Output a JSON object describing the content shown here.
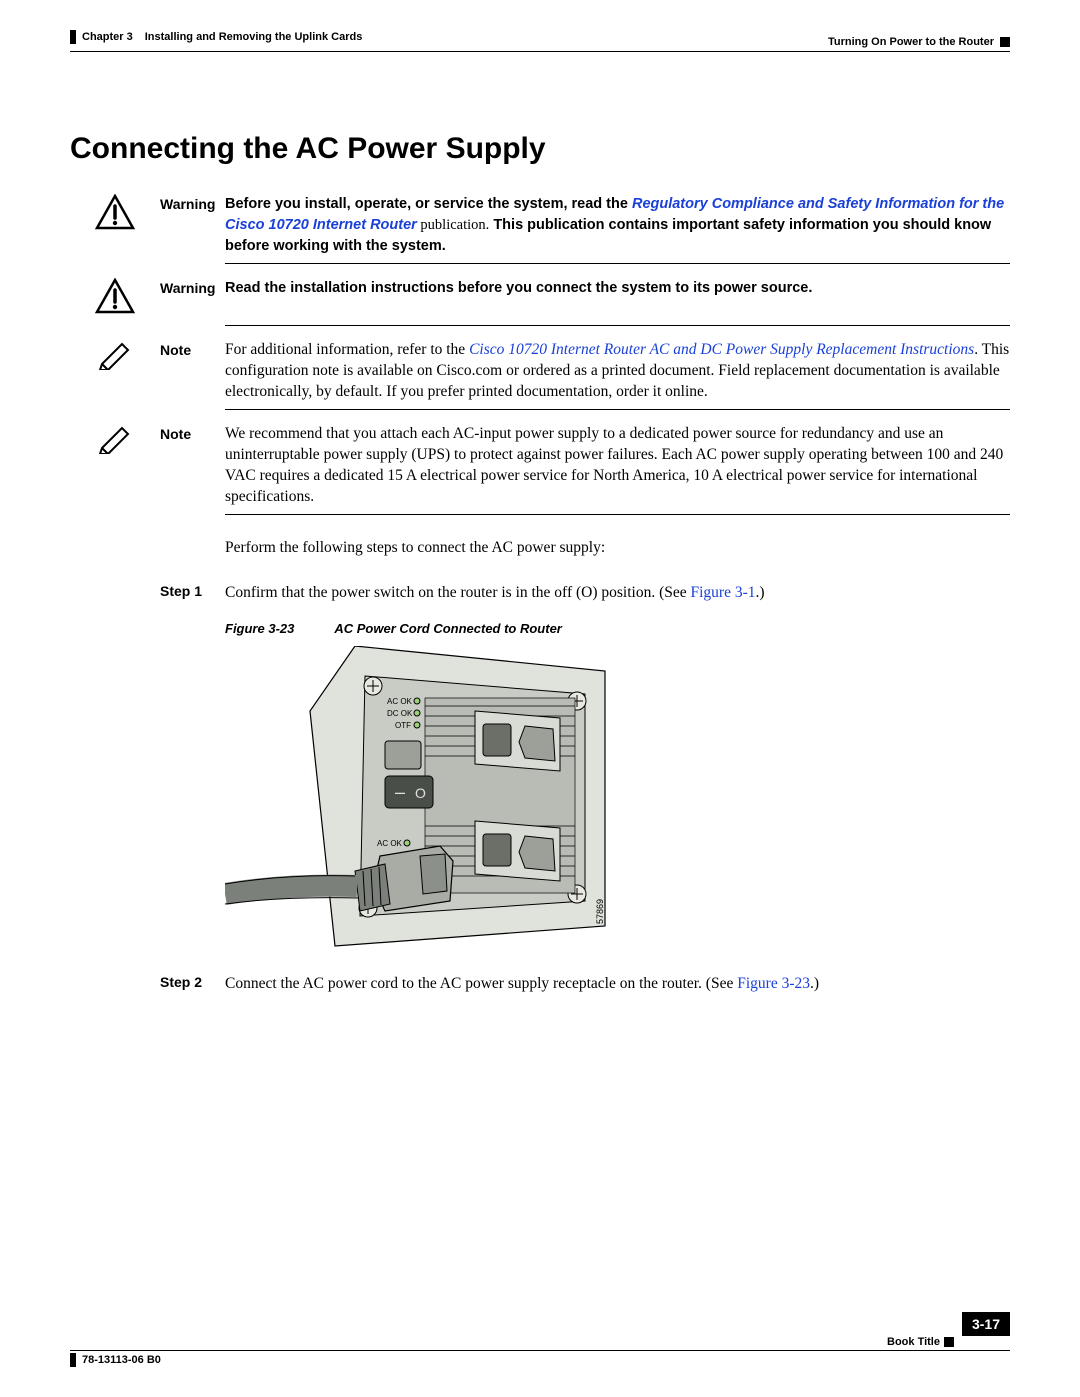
{
  "header": {
    "chapter_label": "Chapter 3",
    "chapter_title": "Installing and Removing the Uplink Cards",
    "section_title": "Turning On Power to the Router"
  },
  "heading": "Connecting the AC Power Supply",
  "warning_label": "Warning",
  "note_label": "Note",
  "warning1": {
    "pre": "Before you install, operate, or service the system, read the ",
    "link": "Regulatory Compliance and Safety Information for the Cisco 10720 Internet Router",
    "post_bold": " publication.",
    "post": " This publication contains important safety information you should know before working with the system."
  },
  "warning2": "Read the installation instructions before you connect the system to its power source.",
  "note1": {
    "pre": "For additional information, refer to the ",
    "link": "Cisco 10720 Internet Router AC and DC Power Supply Replacement Instructions",
    "post": ". This configuration note is available on Cisco.com or ordered as a printed document. Field replacement documentation is available electronically, by default. If you prefer printed documentation, order it online."
  },
  "note2": "We recommend that you attach each AC-input power supply to a dedicated power source for redundancy and use an uninterruptable power supply (UPS) to protect against power failures. Each AC power supply operating between 100 and 240 VAC requires a dedicated 15 A electrical power service for North America, 10 A electrical power service for international specifications.",
  "intro": "Perform the following steps to connect the AC power supply:",
  "steps": {
    "s1_label": "Step 1",
    "s1_text": "Confirm that the power switch on the router is in the off (O) position. (See ",
    "s1_link": "Figure 3-1",
    "s1_after": ".)",
    "s2_label": "Step 2",
    "s2_text": "Connect the AC power cord to the AC power supply receptacle on the router. (See ",
    "s2_link": "Figure 3-23",
    "s2_after": ".)"
  },
  "figure": {
    "num": "Figure 3-23",
    "caption": "AC Power Cord Connected to Router",
    "id": "57869",
    "labels": {
      "acok": "AC OK",
      "dcok": "DC OK",
      "otf": "OTF",
      "acok2": "AC OK"
    },
    "switch": {
      "off": "O",
      "on": "–"
    }
  },
  "footer": {
    "book": "Book Title",
    "doc": "78-13113-06 B0",
    "page": "3-17"
  }
}
